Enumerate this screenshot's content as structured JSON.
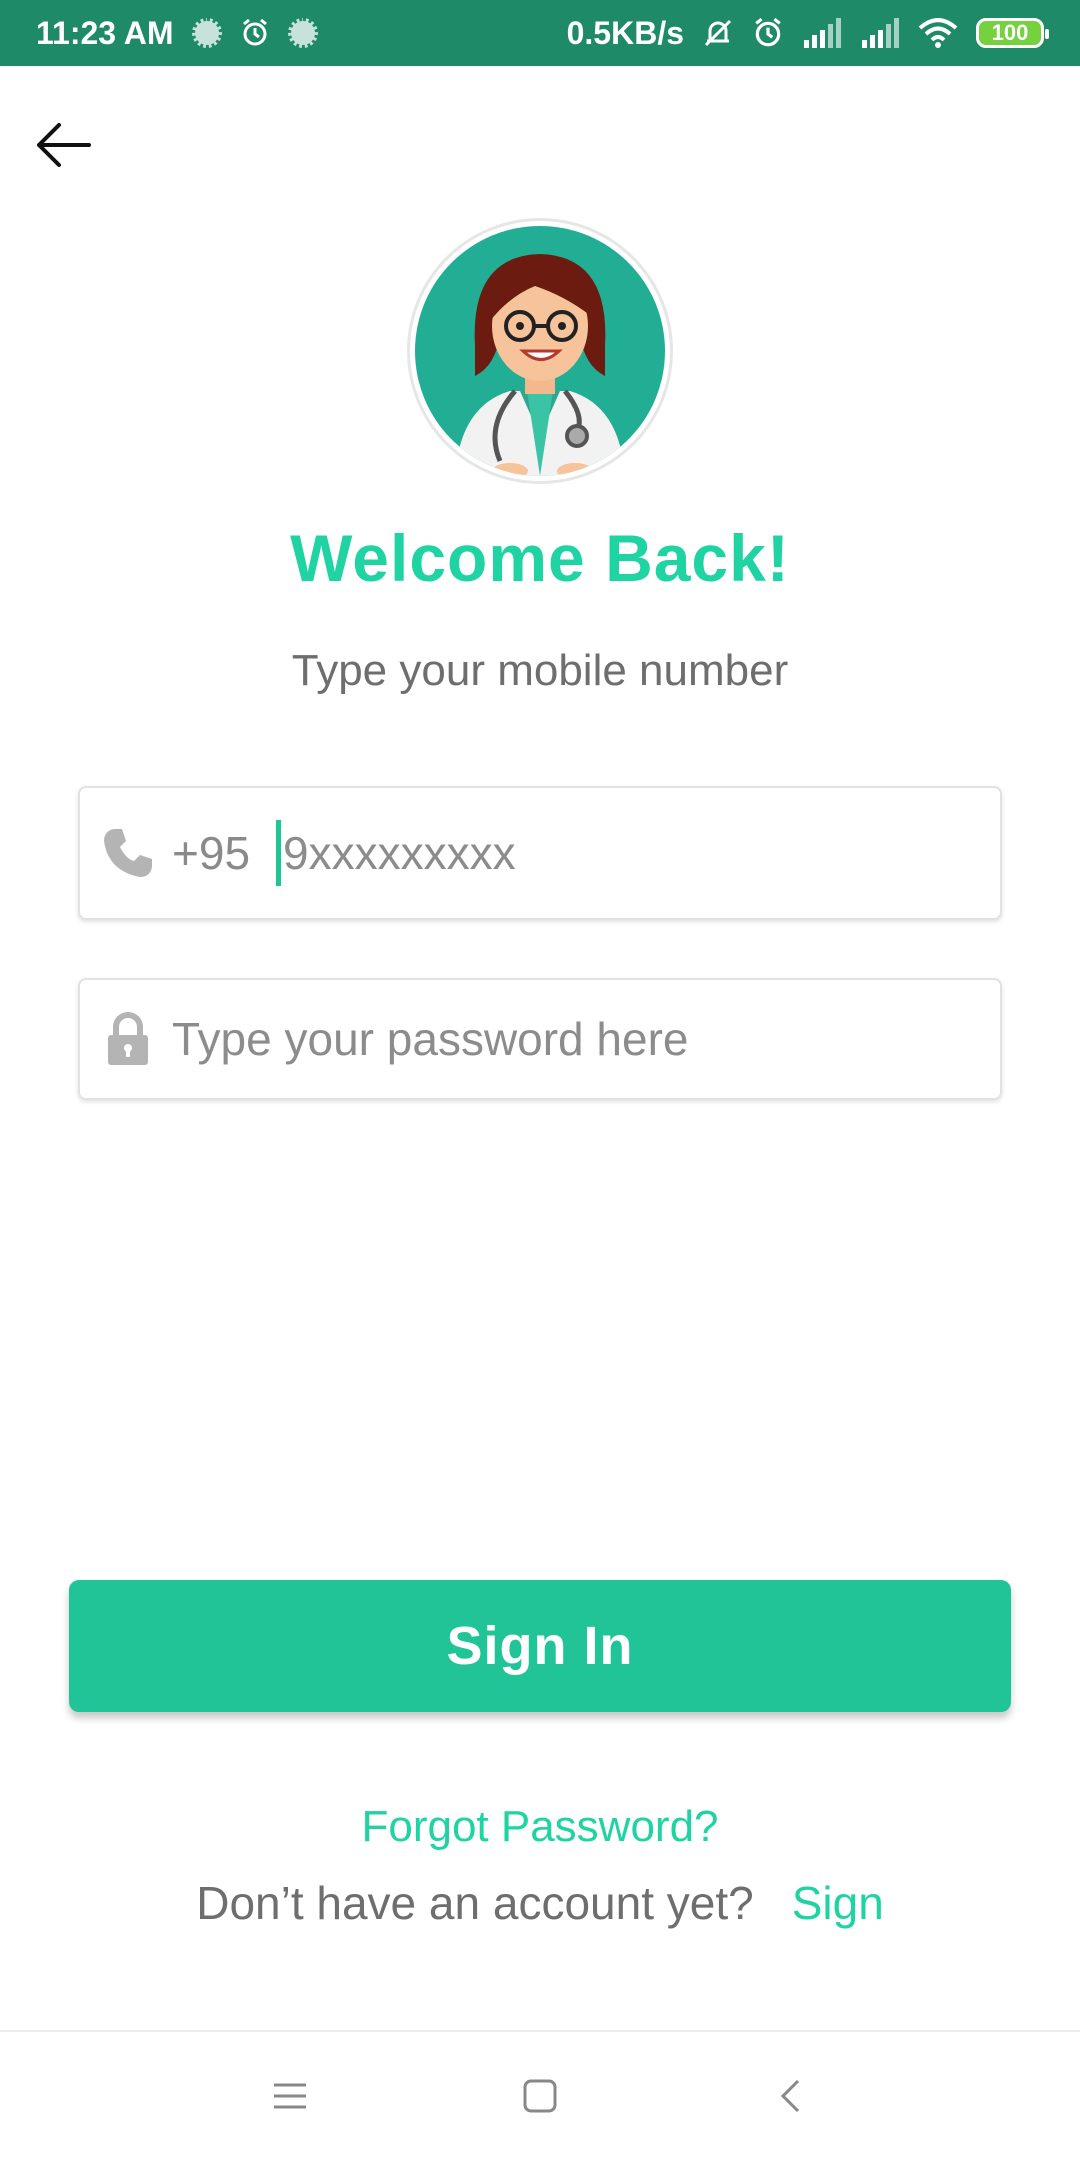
{
  "status_bar": {
    "time": "11:23 AM",
    "network_speed": "0.5KB/s",
    "battery": "100",
    "icons": [
      "notification-dot-icon",
      "alarm-icon",
      "notification-dot-icon",
      "bell-muted-icon",
      "alarm-icon",
      "signal-icon",
      "signal-icon",
      "wifi-icon",
      "battery-icon"
    ]
  },
  "header": {
    "back_icon": "arrow-left-icon"
  },
  "welcome": {
    "title": "Welcome Back!",
    "subtitle": "Type your mobile number"
  },
  "phone": {
    "icon": "phone-icon",
    "country_code": "+95",
    "placeholder": "9xxxxxxxxx",
    "value": ""
  },
  "password": {
    "icon": "lock-icon",
    "placeholder": "Type your password here",
    "value": ""
  },
  "actions": {
    "sign_in_label": "Sign In",
    "forgot_label": "Forgot Password?",
    "signup_prompt": "Don’t have an account yet?",
    "signup_link": "Sign"
  },
  "nav": {
    "items": [
      "menu-icon",
      "home-square-icon",
      "back-chevron-icon"
    ]
  },
  "colors": {
    "status_bar": "#1e8a68",
    "accent": "#1fd4a2",
    "button": "#20c497",
    "battery": "#76d13e"
  }
}
